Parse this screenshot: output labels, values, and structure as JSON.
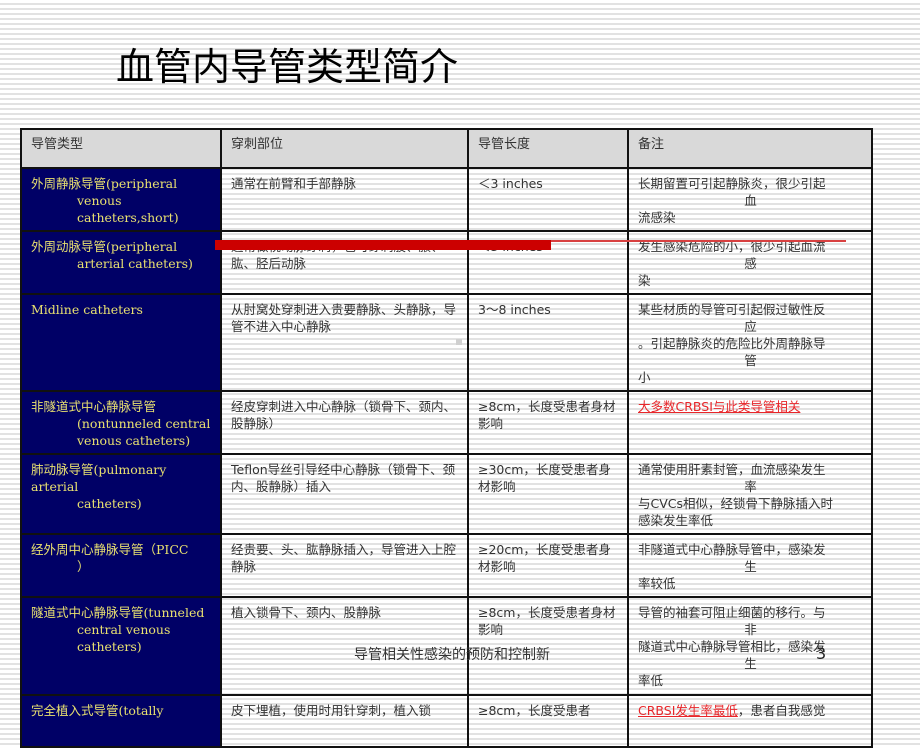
{
  "slide": {
    "title": "血管内导管类型简介",
    "footer": "导管相关性感染的预防和控制新",
    "page_number": "3"
  },
  "table": {
    "headers": [
      "导管类型",
      "穿刺部位",
      "导管长度",
      "备注"
    ],
    "rows": [
      {
        "type_cn": "外周静脉导管(peripheral",
        "type_en": "venous catheters,short)",
        "site": "通常在前臂和手部静脉",
        "length": "＜3  inches",
        "note_lines": [
          "长期留置可引起静脉炎，很少引起",
          "血",
          "流感染"
        ]
      },
      {
        "type_cn": "外周动脉导管(peripheral",
        "type_en": "arterial catheters)",
        "site": "通常做桡动脉穿刺，也可穿刺股、腋、肱、胫后动脉",
        "length": "＜3  inches",
        "note_lines": [
          "发生感染危险的小，很少引起血流",
          "感",
          "染"
        ]
      },
      {
        "type_cn": "Midline catheters",
        "type_en": "",
        "site": "从肘窝处穿刺进入贵要静脉、头静脉，导管不进入中心静脉",
        "length": "3～8  inches",
        "note_lines": [
          "某些材质的导管可引起假过敏性反",
          "应",
          "。引起静脉炎的危险比外周静脉导",
          "管",
          "小"
        ]
      },
      {
        "type_cn": "非隧道式中心静脉导管",
        "type_en": "(nontunneled central venous catheters)",
        "site": "经皮穿刺进入中心静脉（锁骨下、颈内、股静脉）",
        "length": "≥8cm，长度受患者身材影响",
        "note": "大多数CRBSI与此类导管相关"
      },
      {
        "type_cn": "肺动脉导管(pulmonary arterial",
        "type_en": "catheters)",
        "site": "Teflon导丝引导经中心静脉（锁骨下、颈内、股静脉）插入",
        "length": "≥30cm，长度受患者身材影响",
        "note_lines": [
          "通常使用肝素封管，血流感染发生",
          "率",
          "与CVCs相似，经锁骨下静脉插入时",
          "感染发生率低"
        ]
      },
      {
        "type_cn": "经外周中心静脉导管（PICC",
        "type_en": "）",
        "site": "经贵要、头、肱静脉插入，导管进入上腔静脉",
        "length": "≥20cm，长度受患者身材影响",
        "note_lines": [
          "非隧道式中心静脉导管中，感染发",
          "生",
          "率较低"
        ]
      },
      {
        "type_cn": "隧道式中心静脉导管(tunneled",
        "type_en": "central venous catheters)",
        "site": "植入锁骨下、颈内、股静脉",
        "length": "≥8cm，长度受患者身材影响",
        "note_lines": [
          "导管的袖套可阻止细菌的移行。与",
          "非",
          "隧道式中心静脉导管相比，感染发",
          "生",
          "率低"
        ]
      },
      {
        "type_cn": "完全植入式导管(totally",
        "type_en": "",
        "site": "皮下埋植，使用时用针穿刺，植入锁",
        "length": "≥8cm，长度受患者",
        "note_red": "CRBSI发生率最低",
        "note_rest": "，患者自我感觉"
      }
    ]
  },
  "colors": {
    "type_column_bg": "#000066",
    "type_column_text": "#e8e070",
    "header_bg": "#d9d9d9",
    "highlight_red": "#e8262a",
    "strike_bar": "#cc0000"
  }
}
